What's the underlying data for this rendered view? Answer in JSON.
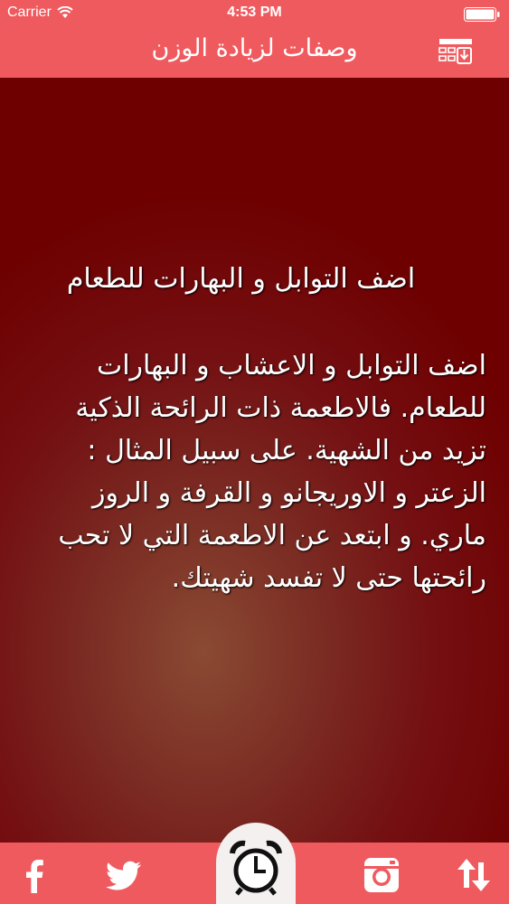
{
  "status_bar": {
    "carrier": "Carrier",
    "time": "4:53 PM"
  },
  "nav": {
    "title": "وصفات لزيادة الوزن",
    "menu_icon": "save-list-icon"
  },
  "article": {
    "title": "اضف التوابل و البهارات للطعام",
    "body": "اضف التوابل  و الاعشاب و البهارات للطعام. فالاطعمة ذات الرائحة الذكية تزيد من الشهية.  على سبيل المثال : الزعتر و الاوريجانو و  القرفة و  الروز ماري. و ابتعد عن الاطعمة التي لا تحب رائحتها حتى لا تفسد شهيتك."
  },
  "tab_bar": {
    "items": [
      "facebook-icon",
      "twitter-icon",
      "alarm-clock-icon",
      "instagram-icon",
      "share-icon"
    ]
  },
  "colors": {
    "accent": "#ef5a5e",
    "content_dark": "#6e0000",
    "center_button": "#f4f0f0"
  }
}
